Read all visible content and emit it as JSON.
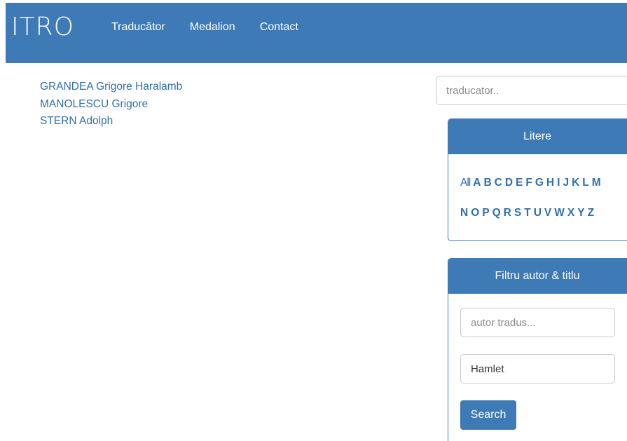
{
  "navbar": {
    "brand": "ITRO",
    "links": [
      "Traducător",
      "Medalion",
      "Contact"
    ]
  },
  "results": [
    "GRANDEA Grigore Haralamb",
    "MANOLESCU Grigore",
    "STERN Adolph"
  ],
  "search": {
    "placeholder": "traducator.."
  },
  "litere": {
    "title": "Litere",
    "row1": [
      "All",
      "A",
      "B",
      "C",
      "D",
      "E",
      "F",
      "G",
      "H",
      "I",
      "J",
      "K",
      "L",
      "M"
    ],
    "row2": [
      "N",
      "O",
      "P",
      "Q",
      "R",
      "S",
      "T",
      "U",
      "V",
      "W",
      "X",
      "Y",
      "Z"
    ]
  },
  "filtru": {
    "title": "Filtru autor & titlu",
    "author_placeholder": "autor tradus...",
    "title_value": "Hamlet",
    "button_label": "Search"
  },
  "colors": {
    "primary": "#3e7ab5",
    "link": "#2e6fb0"
  }
}
